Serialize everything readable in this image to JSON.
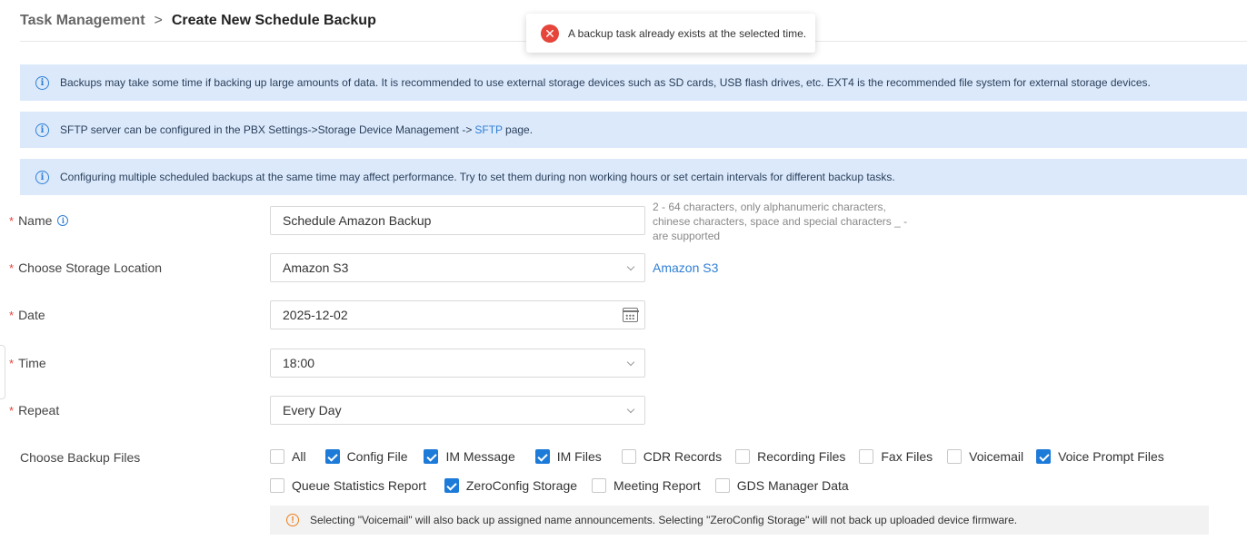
{
  "breadcrumb": {
    "parent": "Task Management",
    "separator": ">",
    "current": "Create New Schedule Backup"
  },
  "toast": {
    "icon": "error-icon",
    "message": "A backup task already exists at the selected time.",
    "color": "#e5453a"
  },
  "notices": [
    {
      "icon": "info-icon",
      "text": "Backups may take some time if backing up large amounts of data. It is recommended to use external storage devices such as SD cards, USB flash drives, etc. EXT4 is the recommended file system for external storage devices."
    },
    {
      "icon": "info-icon",
      "text_before": "SFTP server can be configured in the PBX Settings->Storage Device Management ->",
      "link": "SFTP",
      "text_after": "page."
    },
    {
      "icon": "info-icon",
      "text": "Configuring multiple scheduled backups at the same time may affect performance. Try to set them during non working hours or set certain intervals for different backup tasks."
    }
  ],
  "form": {
    "required_mark": "*",
    "name": {
      "label": "Name",
      "value": "Schedule Amazon Backup",
      "hint": "2 - 64 characters, only alphanumeric characters, chinese characters, space and special characters _ - are supported"
    },
    "storage": {
      "label": "Choose Storage Location",
      "value": "Amazon S3",
      "link": "Amazon S3"
    },
    "date": {
      "label": "Date",
      "value": "2025-12-02"
    },
    "time": {
      "label": "Time",
      "value": "18:00"
    },
    "repeat": {
      "label": "Repeat",
      "value": "Every Day"
    },
    "backup_files": {
      "label": "Choose Backup Files",
      "row1": [
        {
          "label": "All",
          "checked": false
        },
        {
          "label": "Config File",
          "checked": true
        },
        {
          "label": "IM Message",
          "checked": true
        },
        {
          "label": "IM Files",
          "checked": true
        },
        {
          "label": "CDR Records",
          "checked": false
        },
        {
          "label": "Recording Files",
          "checked": false
        },
        {
          "label": "Fax Files",
          "checked": false
        },
        {
          "label": "Voicemail",
          "checked": false
        },
        {
          "label": "Voice Prompt Files",
          "checked": true
        }
      ],
      "row2": [
        {
          "label": "Queue Statistics Report",
          "checked": false
        },
        {
          "label": "ZeroConfig Storage",
          "checked": true
        },
        {
          "label": "Meeting Report",
          "checked": false
        },
        {
          "label": "GDS Manager Data",
          "checked": false
        }
      ]
    },
    "warning": {
      "icon": "warning-icon",
      "text": "Selecting \"Voicemail\" will also back up assigned name announcements. Selecting \"ZeroConfig Storage\" will not back up uploaded device firmware."
    }
  },
  "colors": {
    "accent": "#1c7ad8",
    "notice_bg": "#dbe9fb",
    "link": "#2f7fd6",
    "error": "#e5453a",
    "warning": "#f07d1a"
  }
}
